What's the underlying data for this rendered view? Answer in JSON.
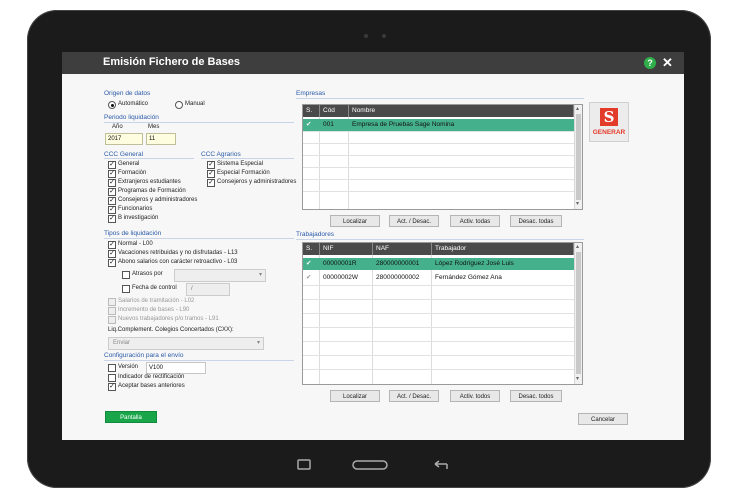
{
  "window": {
    "title": "Emisión Fichero de Bases",
    "help_label": "?",
    "close_label": "✕"
  },
  "origen": {
    "title": "Origen de datos",
    "automatico": "Automático",
    "manual": "Manual",
    "selected": "Automático"
  },
  "periodo": {
    "title": "Periodo liquidación",
    "anio_label": "Año",
    "mes_label": "Mes",
    "anio": "2017",
    "mes": "11"
  },
  "ccc_general": {
    "title": "CCC General",
    "items": [
      {
        "label": "General",
        "checked": true
      },
      {
        "label": "Formación",
        "checked": true
      },
      {
        "label": "Extranjeros estudiantes",
        "checked": true
      },
      {
        "label": "Programas de Formación",
        "checked": true
      },
      {
        "label": "Consejeros y administradores",
        "checked": true
      },
      {
        "label": "Funcionarios",
        "checked": true
      },
      {
        "label": "B investigación",
        "checked": true
      }
    ]
  },
  "ccc_agrarios": {
    "title": "CCC Agrarios",
    "items": [
      {
        "label": "Sistema Especial",
        "checked": true
      },
      {
        "label": "Especial Formación",
        "checked": true
      },
      {
        "label": "Consejeros y administradores",
        "checked": true
      }
    ]
  },
  "tipos": {
    "title": "Tipos de liquidación",
    "items": [
      {
        "label": "Normal - L00",
        "checked": true
      },
      {
        "label": "Vacaciones retribuidas y no disfrutadas - L13",
        "checked": true
      },
      {
        "label": "Abono salarios con carácter retroactivo - L03",
        "checked": true
      }
    ],
    "atrasos_label": "Atrasos por",
    "fecha_label": "Fecha de control",
    "fecha_value": "/",
    "disabled": [
      {
        "label": "Salarios de tramitación - L02"
      },
      {
        "label": "Incremento de bases - L90"
      },
      {
        "label": "Nuevos trabajadores p/o tramos - L91"
      }
    ],
    "liq_label": "Liq.Complement. Colegios Concertados (CXX):",
    "enviar": "Enviar"
  },
  "configuracion": {
    "title": "Configuración para el envío",
    "version_label": "Versión",
    "version_value": "V100",
    "indicador_label": "Indicador de rectificación",
    "aceptar_label": "Aceptar bases anteriores"
  },
  "empresas": {
    "title": "Empresas",
    "columns": [
      "S.",
      "Cód",
      "Nombre"
    ],
    "rows": [
      {
        "s": "✔",
        "cod": "001",
        "nombre": "Empresa de Pruebas Sage Nomina"
      }
    ]
  },
  "empresas_buttons": {
    "localizar": "Localizar",
    "act": "Act. / Desac.",
    "activ": "Activ. todas",
    "desac": "Desac. todas"
  },
  "trabajadores": {
    "title": "Trabajadores",
    "columns": [
      "S.",
      "NIF",
      "NAF",
      "Trabajador"
    ],
    "rows": [
      {
        "s": "✔",
        "nif": "00000001R",
        "naf": "280000000001",
        "nombre": "López Rodríguez José Luis"
      },
      {
        "s": "✔",
        "nif": "00000002W",
        "naf": "280000000002",
        "nombre": "Fernández Gómez Ana"
      }
    ]
  },
  "trabajadores_buttons": {
    "localizar": "Localizar",
    "act": "Act. / Desac.",
    "activ": "Activ. todos",
    "desac": "Desac. todos"
  },
  "logo": {
    "letter": "S",
    "text": "GENERAR"
  },
  "footer": {
    "pantalla": "Pantalla",
    "cancelar": "Cancelar"
  },
  "colors": {
    "accent": "#19a64a",
    "selected_row": "#45b08c",
    "section_title": "#2a5aa8",
    "logo_red": "#e33b2a"
  },
  "device": {
    "nav_icons": [
      "recent-apps-icon",
      "home-icon",
      "back-icon"
    ]
  }
}
